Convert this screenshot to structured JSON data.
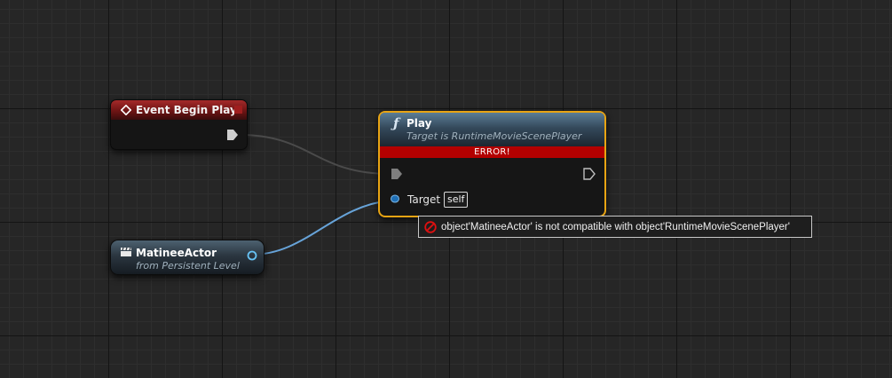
{
  "nodes": {
    "event_begin_play": {
      "title": "Event Begin Play",
      "header_color": "#8b1e1e",
      "icon": "event-diamond-icon"
    },
    "play": {
      "title": "Play",
      "subtitle": "Target is RuntimeMovieScenePlayer",
      "error_banner": "ERROR!",
      "icon": "function-icon",
      "border_color": "#e8a413",
      "pins": {
        "target_label": "Target",
        "target_default": "self"
      }
    },
    "matinee_actor": {
      "title": "MatineeActor",
      "subtitle": "from Persistent Level",
      "icon": "clapperboard-icon"
    }
  },
  "tooltip": {
    "icon": "error-no-entry-icon",
    "message": "object'MatineeActor' is not compatible with object'RuntimeMovieScenePlayer'"
  },
  "colors": {
    "exec_wire": "#4a4a4a",
    "object_wire": "#67a3d8",
    "error_red": "#b30000",
    "graph_background": "#262626"
  }
}
